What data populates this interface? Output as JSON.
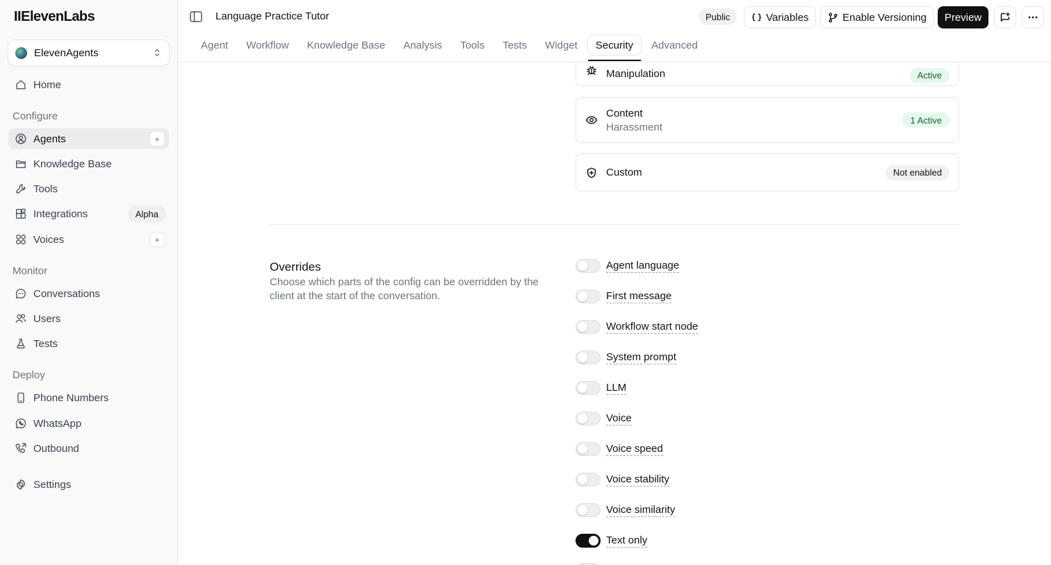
{
  "brand": {
    "logo": "IIElevenLabs"
  },
  "workspace": {
    "name": "ElevenAgents"
  },
  "sidebar": {
    "home": "Home",
    "configure_label": "Configure",
    "agents": "Agents",
    "knowledge_base": "Knowledge Base",
    "tools": "Tools",
    "integrations": "Integrations",
    "integrations_badge": "Alpha",
    "voices": "Voices",
    "monitor_label": "Monitor",
    "conversations": "Conversations",
    "users": "Users",
    "tests": "Tests",
    "deploy_label": "Deploy",
    "phone_numbers": "Phone Numbers",
    "whatsapp": "WhatsApp",
    "outbound": "Outbound",
    "settings": "Settings"
  },
  "header": {
    "title": "Language Practice Tutor",
    "visibility_badge": "Public",
    "variables_label": "Variables",
    "versioning_label": "Enable Versioning",
    "preview_label": "Preview"
  },
  "tabs": [
    "Agent",
    "Workflow",
    "Knowledge Base",
    "Analysis",
    "Tools",
    "Tests",
    "Widget",
    "Security",
    "Advanced"
  ],
  "guardrails": {
    "manipulation": {
      "title": "Manipulation",
      "status": "Active"
    },
    "content": {
      "title": "Content",
      "subtitle": "Harassment",
      "status": "1 Active"
    },
    "custom": {
      "title": "Custom",
      "status": "Not enabled"
    }
  },
  "overrides": {
    "title": "Overrides",
    "description": "Choose which parts of the config can be overridden by the client at the start of the conversation.",
    "items": [
      {
        "label": "Agent language",
        "enabled": false
      },
      {
        "label": "First message",
        "enabled": false
      },
      {
        "label": "Workflow start node",
        "enabled": false
      },
      {
        "label": "System prompt",
        "enabled": false
      },
      {
        "label": "LLM",
        "enabled": false
      },
      {
        "label": "Voice",
        "enabled": false
      },
      {
        "label": "Voice speed",
        "enabled": false
      },
      {
        "label": "Voice stability",
        "enabled": false
      },
      {
        "label": "Voice similarity",
        "enabled": false
      },
      {
        "label": "Text only",
        "enabled": true
      }
    ]
  }
}
